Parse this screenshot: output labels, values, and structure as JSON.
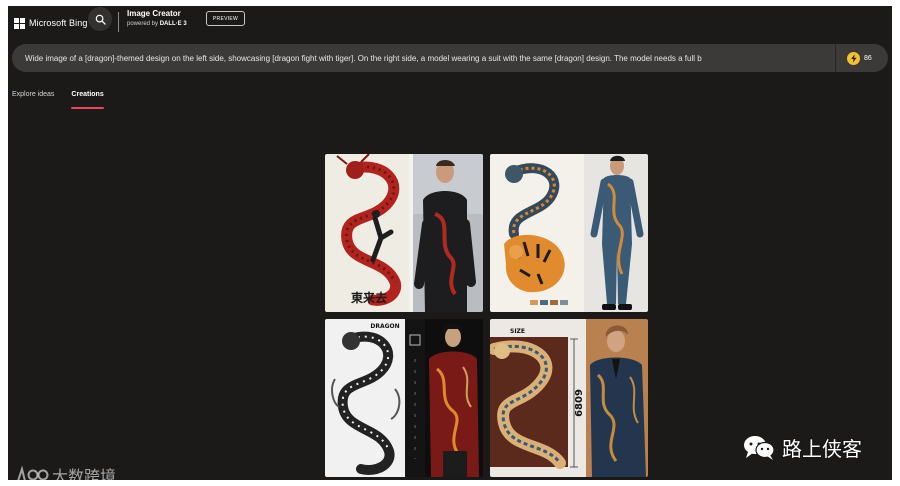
{
  "header": {
    "brand": "Microsoft Bing",
    "product_title": "Image Creator",
    "product_sub_prefix": "powered by ",
    "product_sub_model": "DALL·E 3",
    "preview_badge": "PREVIEW",
    "search_icon": "search-icon"
  },
  "prompt": {
    "text": "Wide image of a [dragon]-themed design on the left side, showcasing [dragon fight with tiger]. On the right side, a model wearing a suit with the same [dragon] design. The model needs a full b",
    "boost_icon": "lightning-bolt-icon",
    "boost_count": "86"
  },
  "tabs": [
    {
      "label": "Explore ideas",
      "active": false
    },
    {
      "label": "Creations",
      "active": true
    }
  ],
  "images": [
    {
      "panel_text": "東来去"
    },
    {
      "panel_text": ""
    },
    {
      "panel_text": "DRAGON"
    },
    {
      "panel_text": "SIZE",
      "vertical_text": "6809"
    }
  ],
  "colors": {
    "app_bg": "#1b1a19",
    "prompt_bg": "#3b3a39",
    "active_tab_underline": "#e8475a",
    "boost_coin": "#f2c12e"
  },
  "watermarks": {
    "left": "大数跨境",
    "left_icon": "logo-mark-icon",
    "right": "路上侠客",
    "right_icon": "wechat-icon"
  }
}
